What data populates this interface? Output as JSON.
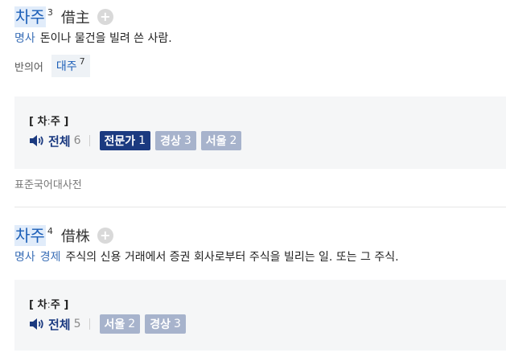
{
  "entries": [
    {
      "headword": "차주",
      "homograph": "3",
      "hanja": "借主",
      "plus_label": "+",
      "pos": "명사",
      "field": "",
      "definition": "돈이나 물건을 빌려 쓴 사람.",
      "antonym_label": "반의어",
      "antonym_word": "대주",
      "antonym_homograph": "7",
      "pron_open": "[ ",
      "pron_first": "차",
      "pron_colon": ":",
      "pron_second": "주",
      "pron_close": " ]",
      "all_label": "전체",
      "all_count": "6",
      "tags": [
        {
          "label": "전문가",
          "count": "1",
          "style": "dark"
        },
        {
          "label": "경상",
          "count": "3",
          "style": "light"
        },
        {
          "label": "서울",
          "count": "2",
          "style": "light"
        }
      ]
    },
    {
      "headword": "차주",
      "homograph": "4",
      "hanja": "借株",
      "plus_label": "+",
      "pos": "명사",
      "field": "경제",
      "definition": "주식의 신용 거래에서 증권 회사로부터 주식을 빌리는 일. 또는 그 주식.",
      "pron_open": "[ ",
      "pron_first": "차",
      "pron_colon": ":",
      "pron_second": "주",
      "pron_close": " ]",
      "all_label": "전체",
      "all_count": "5",
      "tags": [
        {
          "label": "서울",
          "count": "2",
          "style": "light"
        },
        {
          "label": "경상",
          "count": "3",
          "style": "light"
        }
      ]
    }
  ],
  "source": "표준국어대사전",
  "icons": {
    "speaker": "speaker-icon",
    "plus": "plus-circle-icon"
  },
  "colors": {
    "headword": "#1c5fb8",
    "headword_bg": "#e1ecfa",
    "pos": "#3b6fb7",
    "all_label": "#1b3a80",
    "tag_dark": "#1b3a80",
    "tag_light": "#a7b3cc",
    "box_bg": "#f5f6f7"
  }
}
